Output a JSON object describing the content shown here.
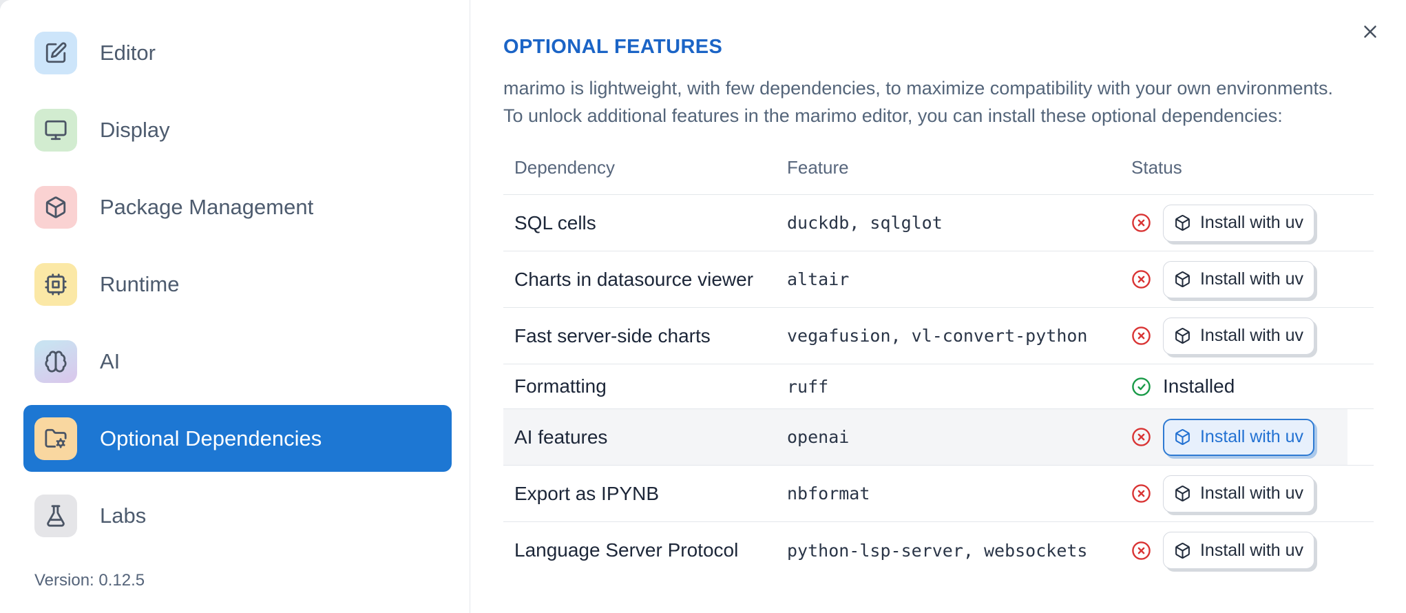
{
  "sidebar": {
    "items": [
      {
        "name": "editor",
        "label": "Editor",
        "icon": "edit",
        "icon_bg": "#cde5fa",
        "selected": false
      },
      {
        "name": "display",
        "label": "Display",
        "icon": "monitor",
        "icon_bg": "#d2ecd0",
        "selected": false
      },
      {
        "name": "package-management",
        "label": "Package Management",
        "icon": "package",
        "icon_bg": "#fad2d2",
        "selected": false
      },
      {
        "name": "runtime",
        "label": "Runtime",
        "icon": "cpu",
        "icon_bg": "#fbe8a6",
        "selected": false
      },
      {
        "name": "ai",
        "label": "AI",
        "icon": "brain",
        "icon_bg": "linear-gradient(155deg,#c9e2f1 15%,#d8c9ec 90%)",
        "selected": false
      },
      {
        "name": "optional-dependencies",
        "label": "Optional Dependencies",
        "icon": "folder-cog",
        "icon_bg": "#f9d7a0",
        "selected": true
      },
      {
        "name": "labs",
        "label": "Labs",
        "icon": "flask",
        "icon_bg": "#e5e5e8",
        "selected": false
      }
    ],
    "version_label": "Version: 0.12.5"
  },
  "panel": {
    "title": "OPTIONAL FEATURES",
    "description_line1": "marimo is lightweight, with few dependencies, to maximize compatibility with your own environments.",
    "description_line2": "To unlock additional features in the marimo editor, you can install these optional dependencies:",
    "table": {
      "headers": [
        "Dependency",
        "Feature",
        "Status"
      ],
      "rows": [
        {
          "name": "sql-cells",
          "dependency": "SQL cells",
          "feature": "duckdb, sqlglot",
          "installed": false,
          "highlighted": false,
          "action": "Install with uv"
        },
        {
          "name": "charts-datasource-viewer",
          "dependency": "Charts in datasource viewer",
          "feature": "altair",
          "installed": false,
          "highlighted": false,
          "action": "Install with uv"
        },
        {
          "name": "fast-server-side-charts",
          "dependency": "Fast server-side charts",
          "feature": "vegafusion, vl-convert-python",
          "installed": false,
          "highlighted": false,
          "action": "Install with uv"
        },
        {
          "name": "formatting",
          "dependency": "Formatting",
          "feature": "ruff",
          "installed": true,
          "highlighted": false,
          "status_text": "Installed"
        },
        {
          "name": "ai-features",
          "dependency": "AI features",
          "feature": "openai",
          "installed": false,
          "highlighted": true,
          "action": "Install with uv"
        },
        {
          "name": "export-ipynb",
          "dependency": "Export as IPYNB",
          "feature": "nbformat",
          "installed": false,
          "highlighted": false,
          "action": "Install with uv"
        },
        {
          "name": "language-server-protocol",
          "dependency": "Language Server Protocol",
          "feature": "python-lsp-server, websockets",
          "installed": false,
          "highlighted": false,
          "action": "Install with uv"
        }
      ]
    }
  },
  "colors": {
    "accent_blue": "#1d77d3",
    "title_blue": "#1b64c6",
    "status_missing_red": "#d93434",
    "status_installed_green": "#189a47",
    "highlighted_row_bg": "#f4f5f7"
  }
}
